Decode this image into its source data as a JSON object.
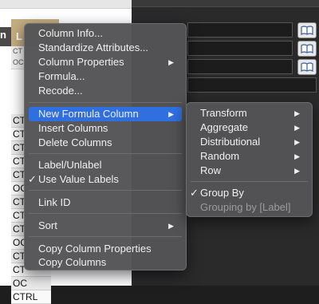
{
  "background": {
    "column_header_left": "n",
    "column_header_selected": "L",
    "meta_rows": [
      "CT",
      "OC"
    ],
    "cell_values": [
      "CT",
      "CT",
      "CT",
      "CT",
      "CT",
      "OC",
      "CT",
      "CT",
      "CT",
      "OC",
      "CT",
      "CT",
      "OC",
      "CTRL"
    ]
  },
  "context_menu": {
    "items": [
      {
        "label": "Column Info..."
      },
      {
        "label": "Standardize Attributes..."
      },
      {
        "label": "Column Properties",
        "arrow": "▶"
      },
      {
        "label": "Formula..."
      },
      {
        "label": "Recode..."
      },
      {
        "label": "New Formula Column",
        "arrow": "▶"
      },
      {
        "label": "Insert Columns"
      },
      {
        "label": "Delete Columns"
      },
      {
        "label": "Label/Unlabel"
      },
      {
        "label": "Use Value Labels",
        "check": "✓"
      },
      {
        "label": "Link ID"
      },
      {
        "label": "Sort",
        "arrow": "▶"
      },
      {
        "label": "Copy Column Properties"
      },
      {
        "label": "Copy Columns"
      }
    ]
  },
  "submenu": {
    "items": [
      {
        "label": "Transform",
        "arrow": "▶"
      },
      {
        "label": "Aggregate",
        "arrow": "▶"
      },
      {
        "label": "Distributional",
        "arrow": "▶"
      },
      {
        "label": "Random",
        "arrow": "▶"
      },
      {
        "label": "Row",
        "arrow": "▶"
      },
      {
        "label": "Group By",
        "check": "✓"
      },
      {
        "label": "Grouping by [Label]"
      }
    ]
  },
  "colors": {
    "highlight": "#2f6fe0",
    "menu_bg": "#545456",
    "header_gold": "#c4ad82"
  }
}
